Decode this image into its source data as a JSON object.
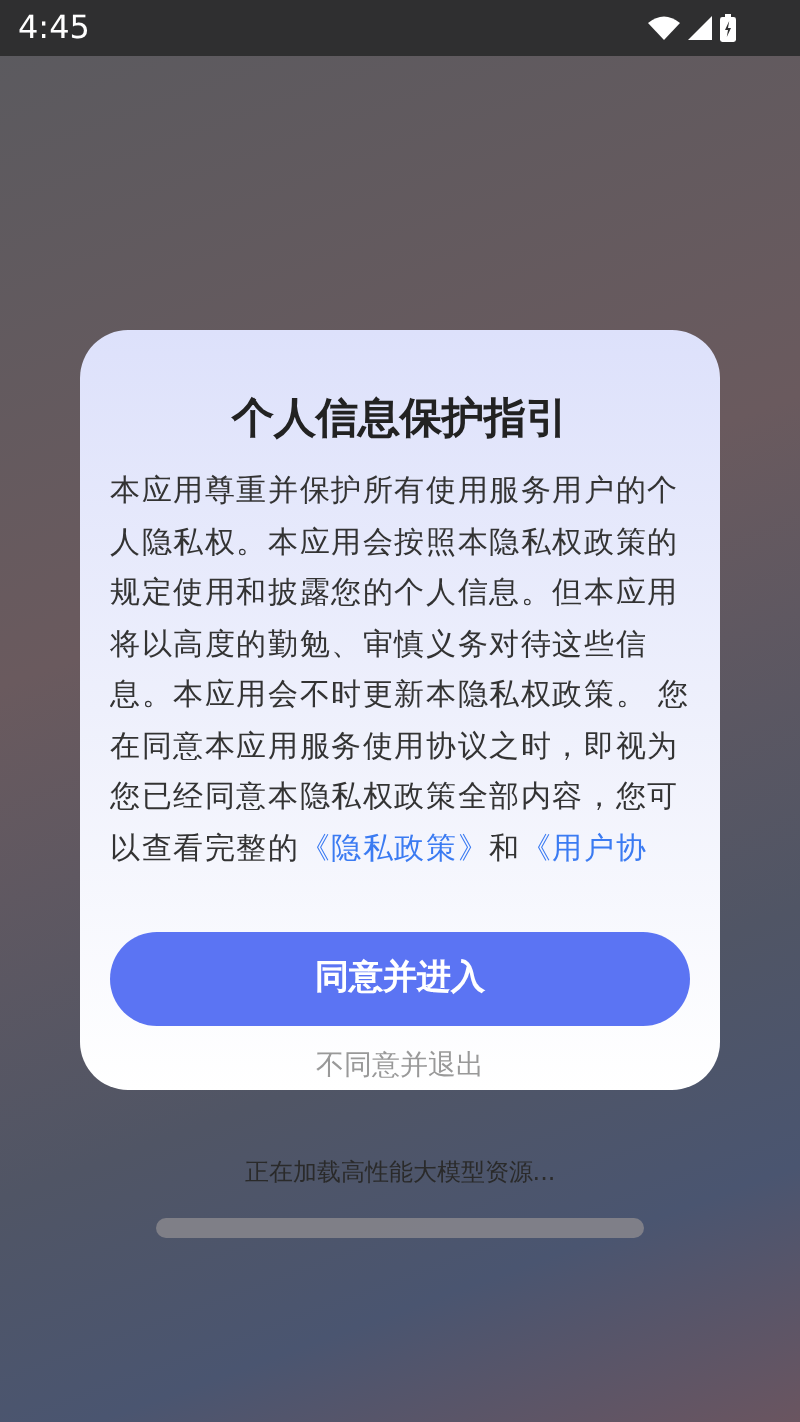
{
  "status_bar": {
    "time": "4:45"
  },
  "dialog": {
    "title": "个人信息保护指引",
    "body": [
      {
        "kind": "text",
        "text": "本应用尊重并保护所有使用服务用户的个人隐私权。本应用会按照本隐私权政策的规定使用和披露您的个人信息。但本应用将以高度的勤勉、审慎义务对待这些信息。本应用会不时更新本隐私权政策。 您在同意本应用服务使用协议之时，即视为您已经同意本隐私权政策全部内容，您可以查看完整的"
      },
      {
        "kind": "link",
        "text": "《隐私政策》"
      },
      {
        "kind": "text",
        "text": "和"
      },
      {
        "kind": "link",
        "text": "《用户协"
      }
    ],
    "primary_button": "同意并进入",
    "secondary_button": "不同意并退出"
  },
  "loading": {
    "text": "正在加载高性能大模型资源..."
  }
}
